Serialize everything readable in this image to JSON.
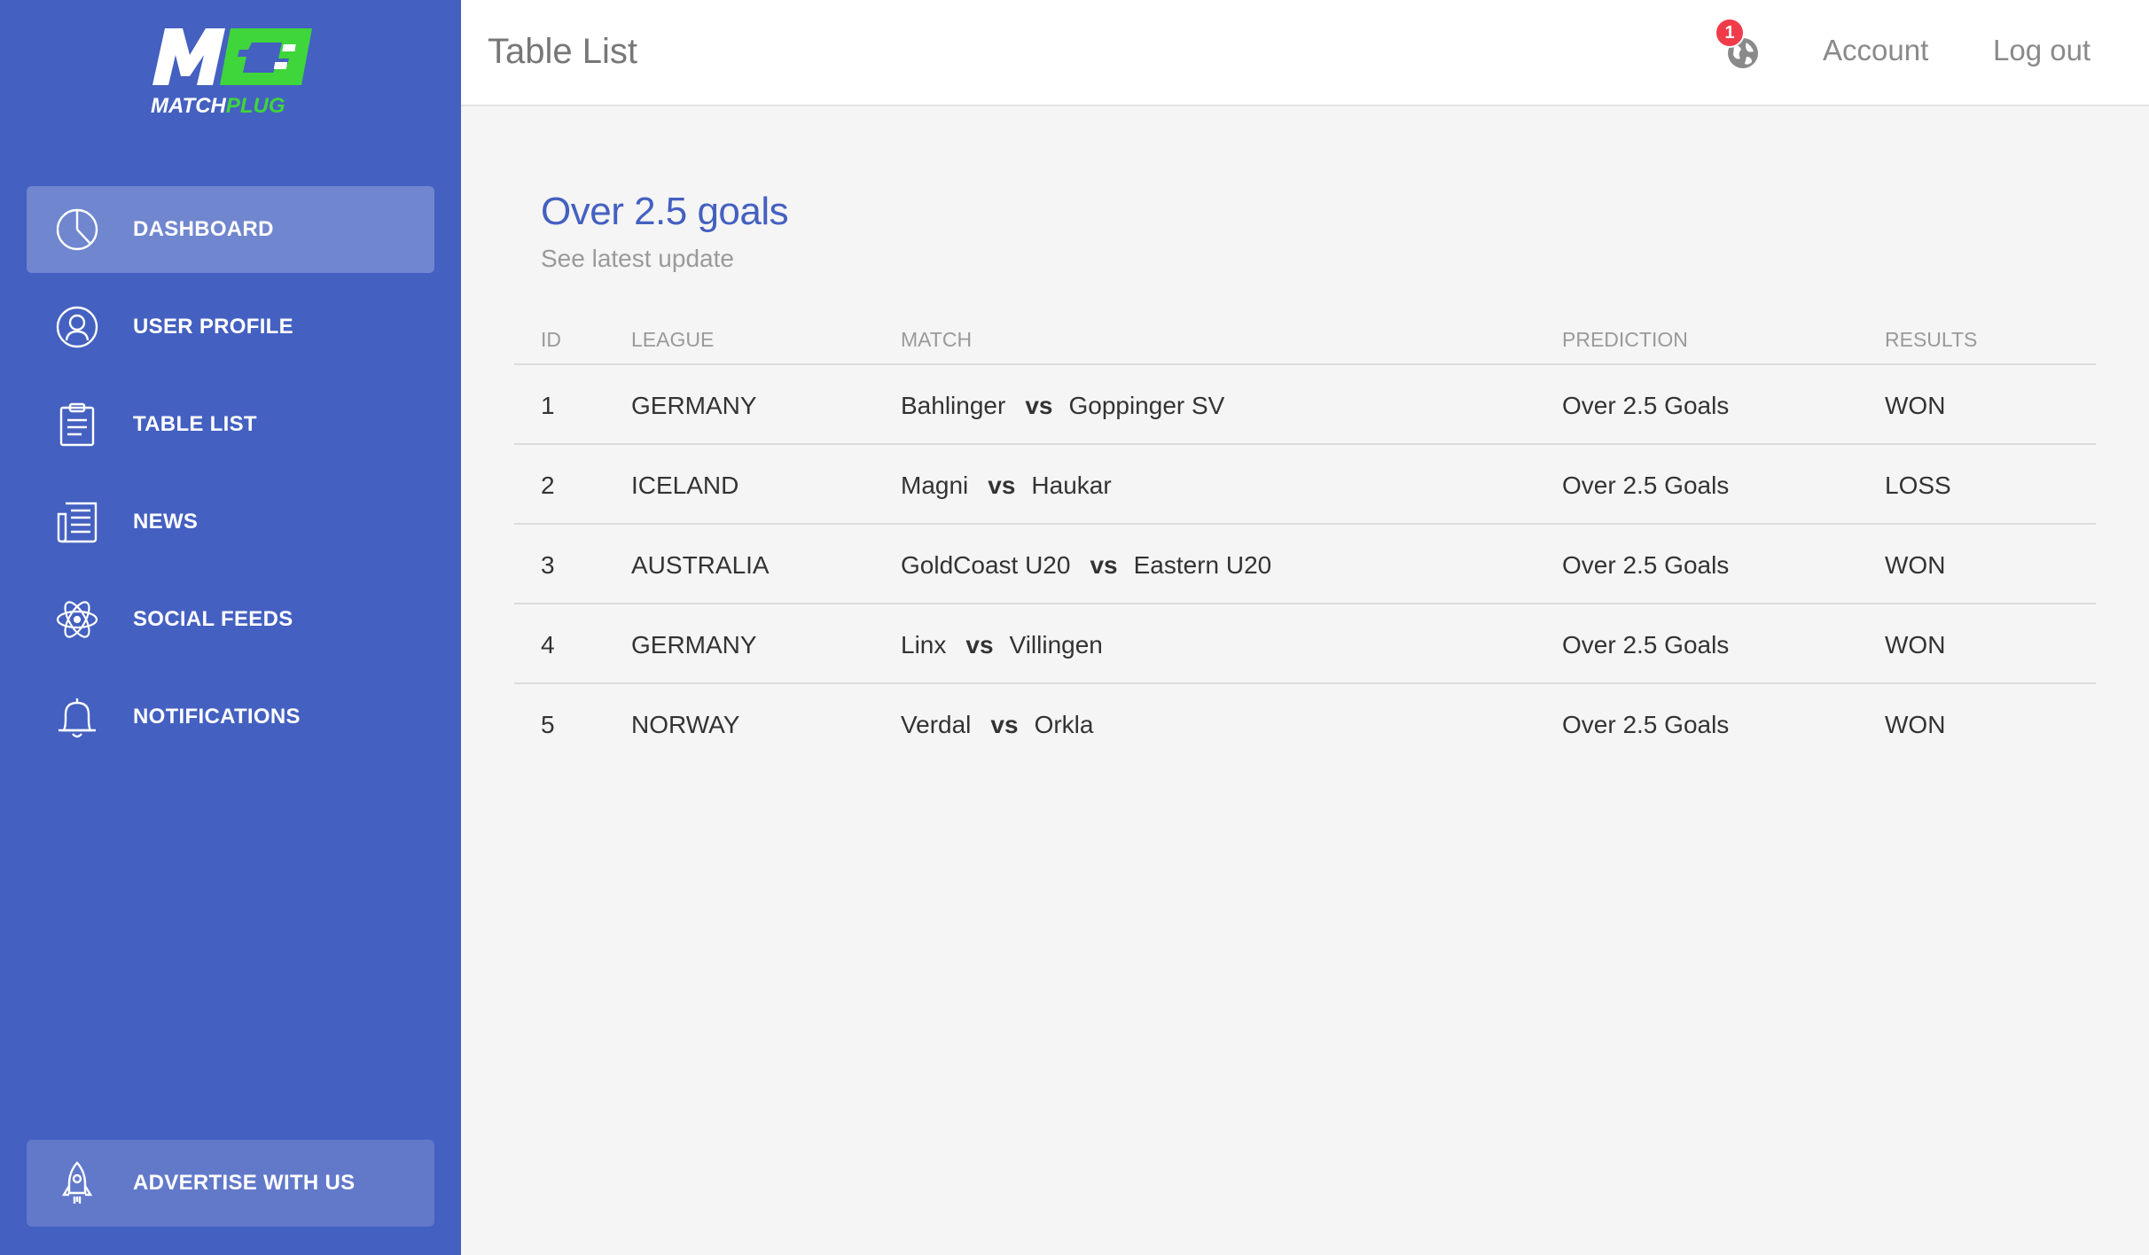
{
  "brand": {
    "name_part1": "MATCH",
    "name_part2": "PLUG",
    "accent": "#3ed63a",
    "sidebar_color": "#4460c0"
  },
  "sidebar": {
    "items": [
      {
        "label": "DASHBOARD",
        "icon": "pie-chart-icon",
        "active": true
      },
      {
        "label": "USER PROFILE",
        "icon": "user-icon",
        "active": false
      },
      {
        "label": "TABLE LIST",
        "icon": "clipboard-icon",
        "active": false
      },
      {
        "label": "NEWS",
        "icon": "newspaper-icon",
        "active": false
      },
      {
        "label": "SOCIAL FEEDS",
        "icon": "atom-icon",
        "active": false
      },
      {
        "label": "NOTIFICATIONS",
        "icon": "bell-icon",
        "active": false
      }
    ],
    "advertise": {
      "label": "ADVERTISE WITH US",
      "icon": "rocket-icon"
    }
  },
  "header": {
    "title": "Table List",
    "notification_count": "1",
    "account_label": "Account",
    "logout_label": "Log out"
  },
  "main": {
    "section_title": "Over 2.5 goals",
    "section_subtitle": "See latest update",
    "table": {
      "columns": [
        "ID",
        "LEAGUE",
        "MATCH",
        "PREDICTION",
        "RESULTS"
      ],
      "vs_label": "vs",
      "rows": [
        {
          "id": "1",
          "league": "GERMANY",
          "home": "Bahlinger",
          "away": "Goppinger SV",
          "prediction": "Over 2.5 Goals",
          "result": "WON"
        },
        {
          "id": "2",
          "league": "ICELAND",
          "home": "Magni",
          "away": "Haukar",
          "prediction": "Over 2.5 Goals",
          "result": "LOSS"
        },
        {
          "id": "3",
          "league": "AUSTRALIA",
          "home": "GoldCoast U20",
          "away": "Eastern U20",
          "prediction": "Over 2.5 Goals",
          "result": "WON"
        },
        {
          "id": "4",
          "league": "GERMANY",
          "home": "Linx",
          "away": "Villingen",
          "prediction": "Over 2.5 Goals",
          "result": "WON"
        },
        {
          "id": "5",
          "league": "NORWAY",
          "home": "Verdal",
          "away": "Orkla",
          "prediction": "Over 2.5 Goals",
          "result": "WON"
        }
      ]
    }
  }
}
